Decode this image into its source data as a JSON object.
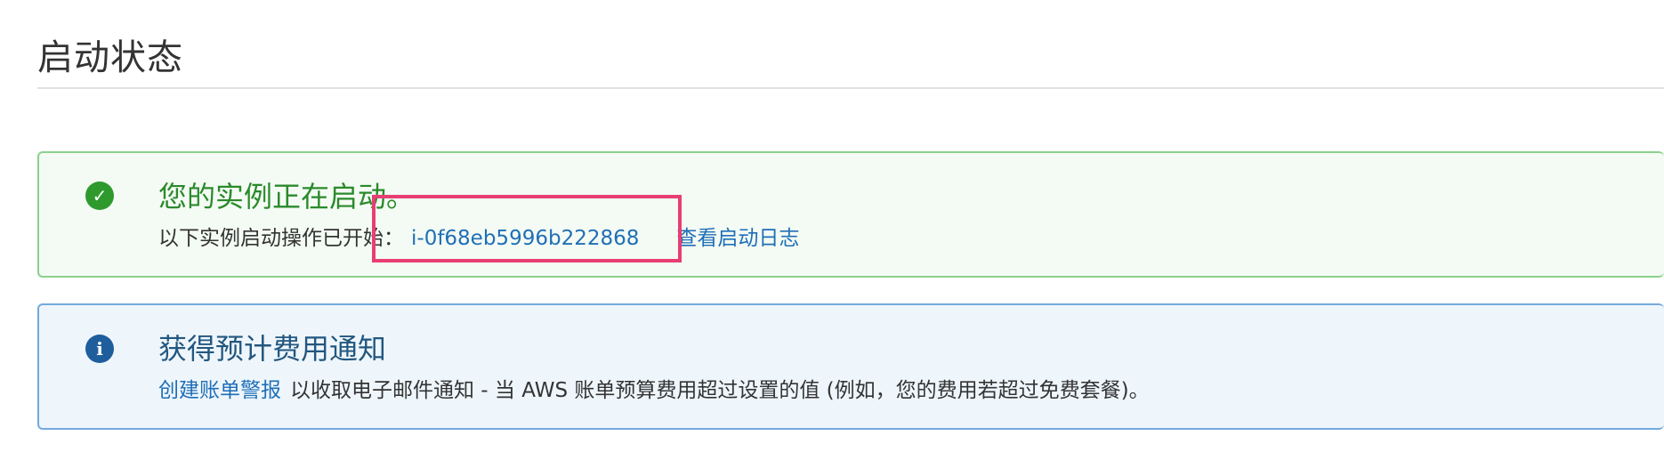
{
  "page": {
    "title": "启动状态"
  },
  "success_alert": {
    "icon": "check-circle-icon",
    "heading": "您的实例正在启动。",
    "body_prefix": "以下实例启动操作已开始：",
    "instance_id": "i-0f68eb5996b222868",
    "view_log_link": "查看启动日志",
    "color": "#2b8a2b"
  },
  "info_alert": {
    "icon": "info-circle-icon",
    "heading": "获得预计费用通知",
    "create_alert_link": "创建账单警报",
    "body_text": "以收取电子邮件通知 - 当 AWS 账单预算费用超过设置的值 (例如，您的费用若超过免费套餐)。",
    "color": "#23577f"
  },
  "highlight": {
    "color": "#e83e74"
  }
}
